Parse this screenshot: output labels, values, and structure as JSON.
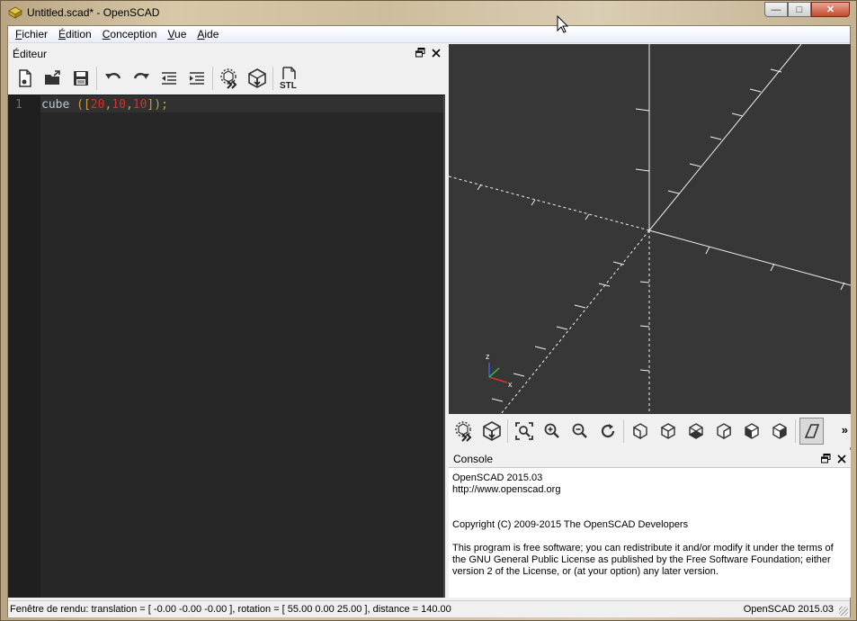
{
  "window": {
    "title": "Untitled.scad* - OpenSCAD",
    "controls": {
      "minimize": "—",
      "maximize": "□",
      "close": "✕"
    }
  },
  "menu": [
    {
      "label": "Fichier",
      "accel": "F",
      "rest": "ichier"
    },
    {
      "label": "Édition",
      "accel": "É",
      "rest": "dition"
    },
    {
      "label": "Conception",
      "accel": "C",
      "rest": "onception"
    },
    {
      "label": "Vue",
      "accel": "V",
      "rest": "ue"
    },
    {
      "label": "Aide",
      "accel": "A",
      "rest": "ide"
    }
  ],
  "editor": {
    "title": "Éditeur",
    "toolbar": [
      "new-file-icon",
      "open-file-icon",
      "save-icon",
      "undo-icon",
      "redo-icon",
      "unindent-icon",
      "indent-icon",
      "preview-icon",
      "render-icon",
      "export-stl-icon"
    ],
    "stl_label": "STL",
    "line_number": "1",
    "code": {
      "keyword": "cube",
      "space": " ",
      "open_paren": "(",
      "open_bracket": "[",
      "n1": "20",
      "c1": ",",
      "n2": "10",
      "c2": ",",
      "n3": "10",
      "close": "]);"
    }
  },
  "viewport": {
    "axis_label_z": "z",
    "axis_label_x": "x"
  },
  "view_toolbar": {
    "buttons": [
      "preview-icon",
      "render-icon",
      "view-all-icon",
      "zoom-in-icon",
      "zoom-out-icon",
      "reset-view-icon",
      "view-right-icon",
      "view-top-icon",
      "view-bottom-icon",
      "view-left-icon",
      "view-front-icon",
      "view-back-icon",
      "perspective-icon"
    ],
    "more": "»"
  },
  "console": {
    "title": "Console",
    "lines": [
      "OpenSCAD 2015.03",
      "http://www.openscad.org",
      "",
      "",
      "Copyright (C) 2009-2015 The OpenSCAD Developers",
      "",
      "This program is free software; you can redistribute it and/or modify it under the terms of the GNU General Public License as published by the Free Software Foundation; either version 2 of the License, or (at your option) any later version."
    ]
  },
  "status": {
    "left": "Fenêtre de rendu: translation = [ -0.00 -0.00 -0.00 ], rotation = [ 55.00 0.00 25.00 ], distance = 140.00",
    "right": "OpenSCAD 2015.03"
  },
  "colors": {
    "editor_bg": "#272727",
    "viewport_bg": "#373737",
    "number": "#d8302c",
    "bracket": "#c7a03a"
  }
}
